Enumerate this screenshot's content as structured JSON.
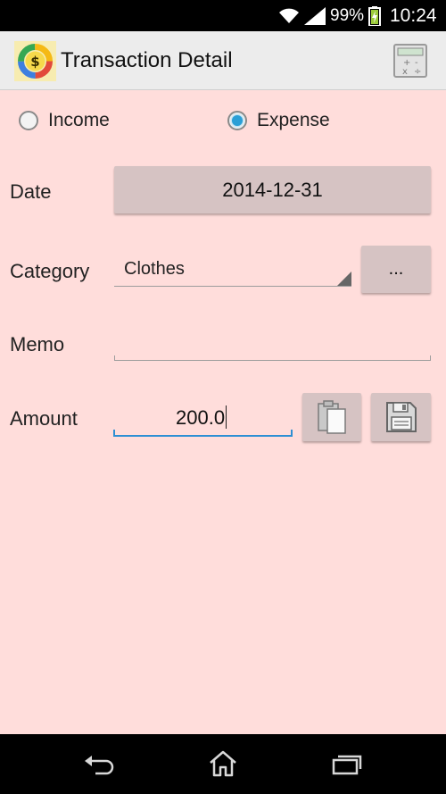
{
  "status_bar": {
    "battery_percent": "99%",
    "time": "10:24"
  },
  "action_bar": {
    "title": "Transaction Detail"
  },
  "type_selector": {
    "options": [
      {
        "label": "Income",
        "selected": false
      },
      {
        "label": "Expense",
        "selected": true
      }
    ]
  },
  "form": {
    "date_label": "Date",
    "date_value": "2014-12-31",
    "category_label": "Category",
    "category_value": "Clothes",
    "category_more_label": "...",
    "memo_label": "Memo",
    "memo_value": "",
    "amount_label": "Amount",
    "amount_value": "200.0"
  },
  "colors": {
    "background": "#ffdddb",
    "button": "#d6c3c3",
    "accent": "#2e8fd3",
    "radio_selected": "#2a9fd6"
  }
}
